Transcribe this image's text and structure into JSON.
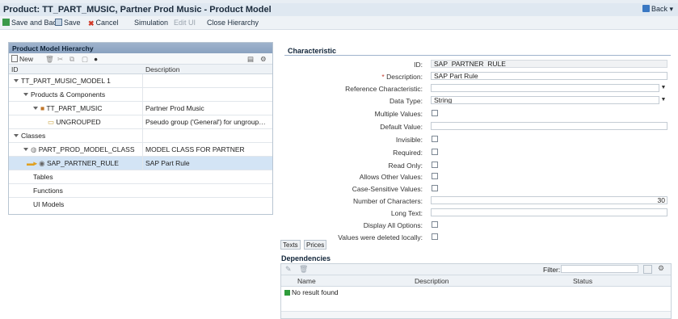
{
  "window": {
    "title": "Product: TT_PART_MUSIC, Partner Prod Music - Product Model",
    "back_label": "Back"
  },
  "toolbar": {
    "save_and_back": "Save and Back",
    "save": "Save",
    "cancel": "Cancel",
    "simulation": "Simulation",
    "edit_ui": "Edit UI",
    "close_hierarchy": "Close Hierarchy"
  },
  "hierarchy": {
    "title": "Product Model Hierarchy",
    "new_label": "New",
    "col_id": "ID",
    "col_description": "Description",
    "rows": [
      {
        "id": "TT_PART_MUSIC_MODEL 1",
        "description": ""
      },
      {
        "id": "Products & Components",
        "description": ""
      },
      {
        "id": "TT_PART_MUSIC",
        "description": "Partner Prod Music"
      },
      {
        "id": "UNGROUPED",
        "description": "Pseudo group ('General') for ungrouped ..."
      },
      {
        "id": "Classes",
        "description": ""
      },
      {
        "id": "PART_PROD_MODEL_CLASS",
        "description": "MODEL CLASS FOR PARTNER"
      },
      {
        "id": "SAP_PARTNER_RULE",
        "description": "SAP Part Rule"
      },
      {
        "id": "Tables",
        "description": ""
      },
      {
        "id": "Functions",
        "description": ""
      },
      {
        "id": "UI Models",
        "description": ""
      }
    ]
  },
  "characteristic": {
    "title": "Characteristic",
    "labels": {
      "id": "ID:",
      "description": "Description:",
      "reference": "Reference Characteristic:",
      "data_type": "Data Type:",
      "multiple_values": "Multiple Values:",
      "default_value": "Default Value:",
      "invisible": "Invisible:",
      "required": "Required:",
      "read_only": "Read Only:",
      "allows_other": "Allows Other Values:",
      "case_sensitive": "Case-Sensitive Values:",
      "num_chars": "Number of Characters:",
      "long_text": "Long Text:",
      "display_all": "Display All Options:",
      "values_deleted": "Values were deleted locally:"
    },
    "values": {
      "id": "SAP_PARTNER_RULE",
      "description": "SAP Part Rule",
      "reference": "",
      "data_type": "String",
      "default_value": "",
      "num_chars": "30",
      "long_text": ""
    },
    "required_marker": "*",
    "tabs": {
      "texts": "Texts",
      "prices": "Prices"
    }
  },
  "dependencies": {
    "title": "Dependencies",
    "filter_label": "Filter:",
    "filter_value": "",
    "columns": {
      "name": "Name",
      "description": "Description",
      "status": "Status"
    },
    "empty_text": "No result found"
  }
}
